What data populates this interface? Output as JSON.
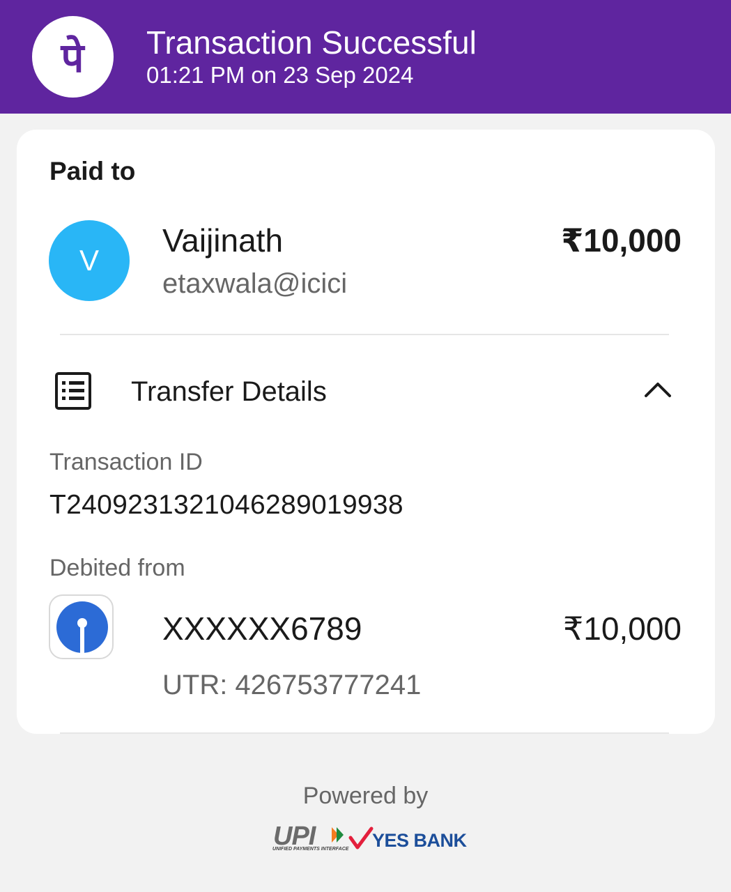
{
  "header": {
    "logo_glyph": "पे",
    "title": "Transaction Successful",
    "subtitle": "01:21 PM on 23 Sep 2024",
    "background": "#5f259f"
  },
  "paid_to": {
    "label": "Paid to",
    "avatar_initial": "V",
    "avatar_color": "#29b6f6",
    "name": "Vaijinath",
    "upi_id": "etaxwala@icici",
    "amount": "₹10,000"
  },
  "transfer_details": {
    "icon": "receipt-icon",
    "title": "Transfer Details",
    "expand_icon": "chevron-up-icon",
    "transaction_id_label": "Transaction ID",
    "transaction_id": "T2409231321046289019938",
    "debited_from_label": "Debited from",
    "bank_icon": "sbi-bank-icon",
    "account": "XXXXXX6789",
    "amount": "₹10,000",
    "utr": "UTR: 426753777241"
  },
  "footer": {
    "powered_by": "Powered by",
    "upi_logo": "UPI",
    "upi_tagline": "UNIFIED PAYMENTS INTERFACE",
    "bank_name": "YES BANK"
  }
}
